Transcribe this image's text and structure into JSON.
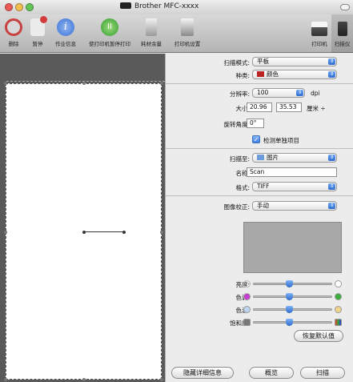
{
  "window": {
    "title": "Brother MFC-xxxx"
  },
  "toolbar": {
    "left": [
      {
        "name": "delete-button",
        "label": "删除",
        "color": "#d33a3a"
      },
      {
        "name": "pause-button",
        "label": "暂停",
        "color": "#d33a3a"
      },
      {
        "name": "job-info-button",
        "label": "作业信息",
        "color": "#3a72d6"
      },
      {
        "name": "resume-printer-button",
        "label": "使打印机暂停打印",
        "color": "#2e9b2e"
      },
      {
        "name": "supply-levels-button",
        "label": "耗材余量",
        "color": "#777777"
      },
      {
        "name": "printer-setup-button",
        "label": "打印机设置",
        "color": "#777777"
      }
    ],
    "right": [
      {
        "name": "printer-tab",
        "label": "打印机"
      },
      {
        "name": "scanner-tab",
        "label": "扫描仪"
      }
    ]
  },
  "panel": {
    "scan_mode": {
      "label": "扫描模式:",
      "value": "平板"
    },
    "kind": {
      "label": "种类:",
      "value": "颜色"
    },
    "resolution": {
      "label": "分辨率:",
      "value": "100",
      "unit": "dpi"
    },
    "size": {
      "label": "大小:",
      "width": "20.96",
      "height": "35.53",
      "unit": "厘米 ÷"
    },
    "rotation": {
      "label": "旋转角度:",
      "value": "0°"
    },
    "detect": {
      "label": "检测单独项目",
      "checked": true
    },
    "scan_to": {
      "label": "扫描至:",
      "value": "图片"
    },
    "name": {
      "label": "名称:",
      "value": "Scan"
    },
    "format": {
      "label": "格式:",
      "value": "TIFF"
    },
    "correction": {
      "label": "图像校正:",
      "value": "手动"
    },
    "sliders": [
      {
        "name": "brightness",
        "label": "亮度:",
        "level": 0.45
      },
      {
        "name": "tint",
        "label": "色调:",
        "level": 0.45
      },
      {
        "name": "temperature",
        "label": "色温:",
        "level": 0.45
      },
      {
        "name": "saturation",
        "label": "饱和度:",
        "level": 0.45
      }
    ],
    "restore_label": "恢复默认值"
  },
  "footer": {
    "hide_details": "隐藏详细信息",
    "overview": "概览",
    "scan": "扫描"
  }
}
